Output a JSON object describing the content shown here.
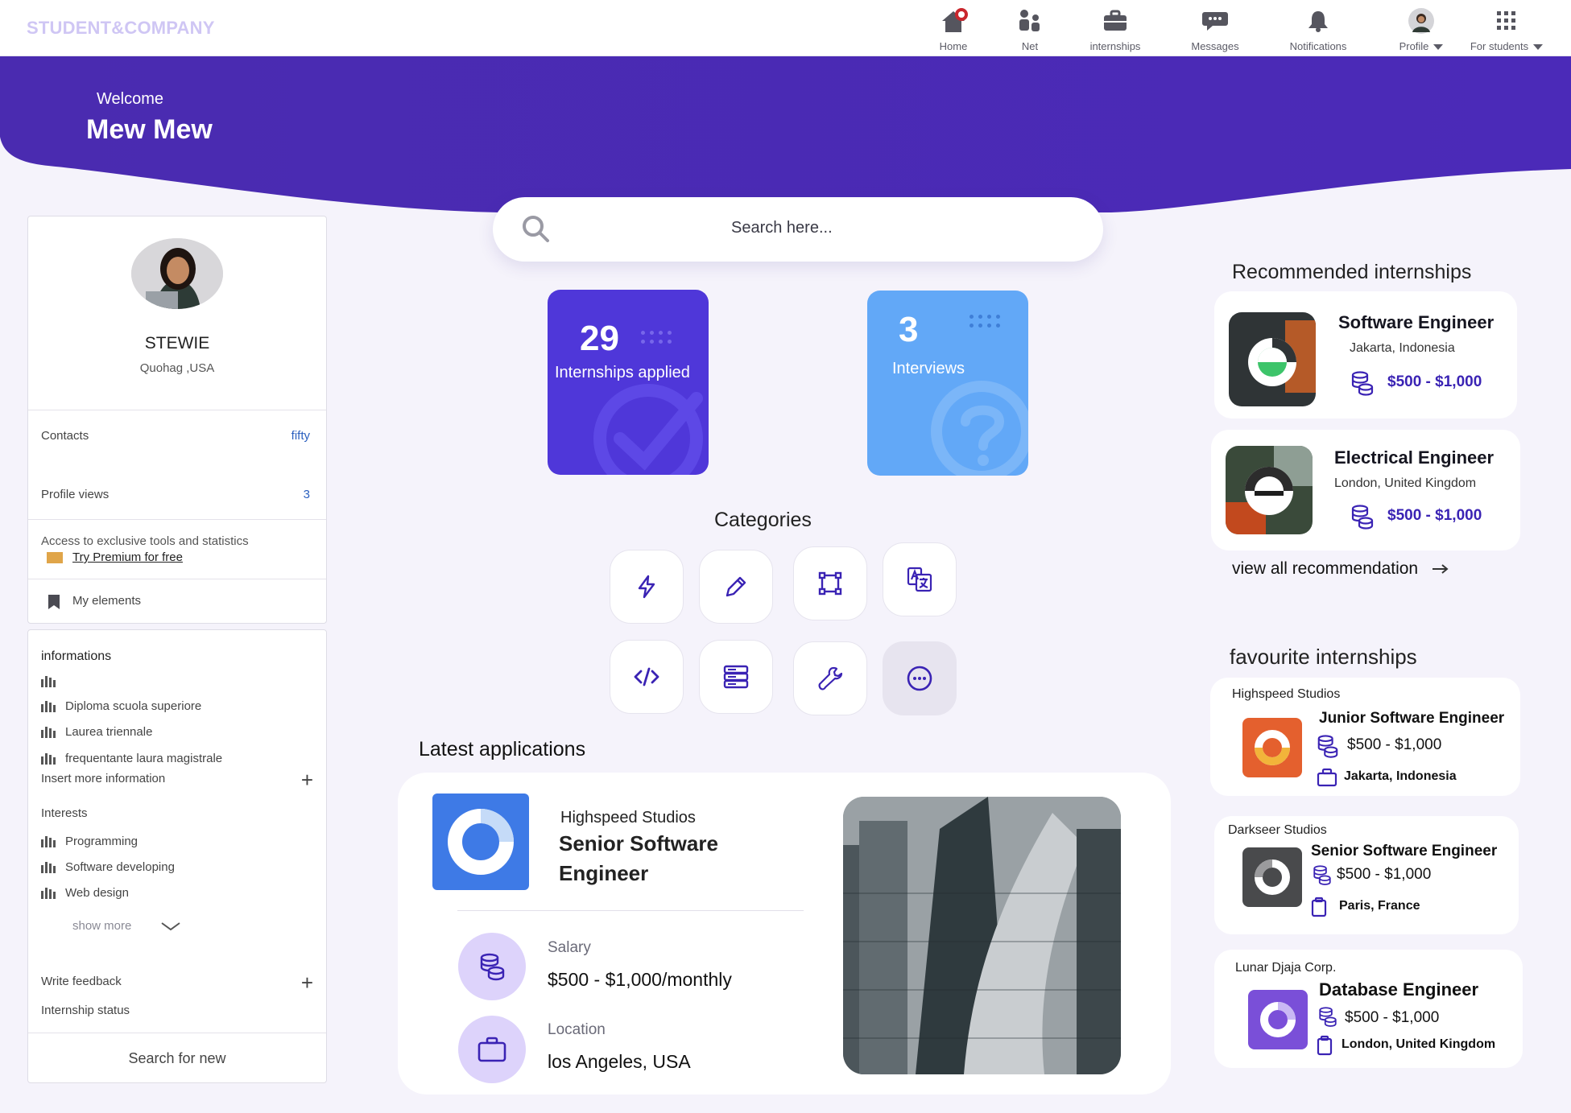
{
  "brand": "STUDENT&COMPANY",
  "nav": {
    "home": "Home",
    "net": "Net",
    "internships": "internships",
    "messages": "Messages",
    "notifications": "Notifications",
    "profile": "Profile",
    "for_students": "For students"
  },
  "hero": {
    "welcome": "Welcome",
    "name": "Mew Mew"
  },
  "search": {
    "placeholder": "Search here..."
  },
  "profile": {
    "name": "STEWIE",
    "location": "Quohag ,USA",
    "contacts_label": "Contacts",
    "contacts_value": "fifty",
    "views_label": "Profile views",
    "views_value": "3",
    "premium_text": "Access to exclusive tools and statistics",
    "premium_link": "Try Premium for free",
    "my_elements": "My elements"
  },
  "informations": {
    "title": "informations",
    "items": [
      "",
      "Diploma scuola superiore",
      "Laurea triennale",
      "frequentante laura magistrale"
    ],
    "insert_more": "Insert more information",
    "interests_label": "Interests",
    "interests": [
      "Programming",
      "Software developing",
      "Web design"
    ],
    "show_more": "show more",
    "write_feedback": "Write feedback",
    "internship_status": "Internship status",
    "search_new": "Search for new"
  },
  "stats": {
    "applied_count": "29",
    "applied_label": "Internships applied",
    "interviews_count": "3",
    "interviews_label": "Interviews"
  },
  "categories": {
    "title": "Categories",
    "icons": [
      "lightning-icon",
      "pencil-icon",
      "vector-shape-icon",
      "translate-icon",
      "code-icon",
      "server-icon",
      "wrench-icon",
      "more-icon"
    ]
  },
  "latest": {
    "title": "Latest applications",
    "company": "Highspeed Studios",
    "job": "Senior Software Engineer",
    "salary_label": "Salary",
    "salary_value": "$500 - $1,000/monthly",
    "location_label": "Location",
    "location_value": "los Angeles, USA"
  },
  "recommended": {
    "title": "Recommended internships",
    "items": [
      {
        "title": "Software Engineer",
        "location": "Jakarta, Indonesia",
        "salary": "$500 - $1,000"
      },
      {
        "title": "Electrical Engineer",
        "location": "London, United Kingdom",
        "salary": "$500 - $1,000"
      }
    ],
    "view_all": "view all recommendation"
  },
  "favourite": {
    "title": "favourite internships",
    "items": [
      {
        "company": "Highspeed Studios",
        "title": "Junior Software Engineer",
        "salary": "$500 - $1,000",
        "location": "Jakarta, Indonesia"
      },
      {
        "company": "Darkseer Studios",
        "title": "Senior Software Engineer",
        "salary": "$500 - $1,000",
        "location": "Paris, France"
      },
      {
        "company": "Lunar Djaja Corp.",
        "title": "Database Engineer",
        "salary": "$500 - $1,000",
        "location": "London, United Kingdom"
      }
    ]
  },
  "colors": {
    "hero": "#4b2bb4",
    "accent": "#3a23b4",
    "tile_applied": "#4f37d9",
    "tile_interviews": "#62a8f7",
    "link": "#2a5fbf"
  }
}
